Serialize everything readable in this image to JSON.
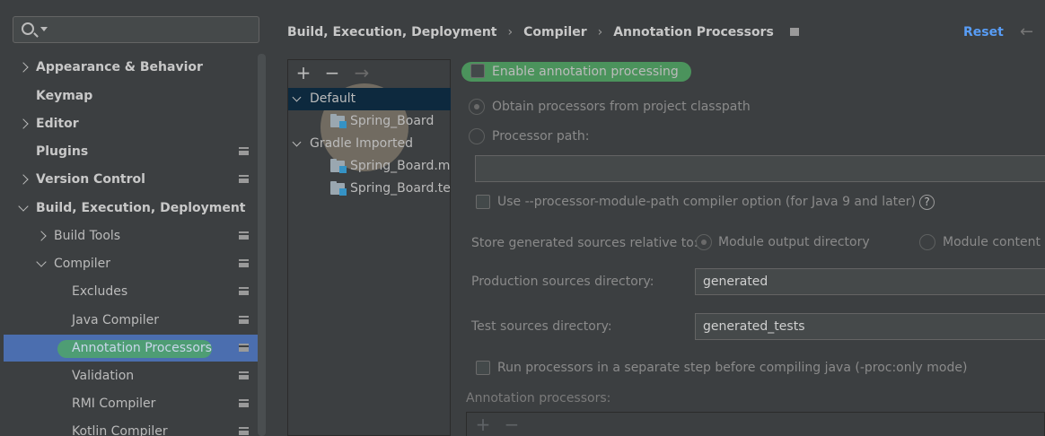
{
  "sidebar": {
    "search": {
      "value": "",
      "placeholder": ""
    },
    "items": [
      {
        "label": "Appearance & Behavior",
        "level": 0,
        "expanded": false,
        "bold": true
      },
      {
        "label": "Keymap",
        "level": 0,
        "bold": true
      },
      {
        "label": "Editor",
        "level": 0,
        "expanded": false,
        "bold": true
      },
      {
        "label": "Plugins",
        "level": 0,
        "bold": true
      },
      {
        "label": "Version Control",
        "level": 0,
        "expanded": false,
        "bold": true
      },
      {
        "label": "Build, Execution, Deployment",
        "level": 0,
        "expanded": true,
        "bold": true
      },
      {
        "label": "Build Tools",
        "level": 1,
        "expanded": false
      },
      {
        "label": "Compiler",
        "level": 1,
        "expanded": true
      },
      {
        "label": "Excludes",
        "level": 2
      },
      {
        "label": "Java Compiler",
        "level": 2
      },
      {
        "label": "Annotation Processors",
        "level": 2,
        "selected": true
      },
      {
        "label": "Validation",
        "level": 2
      },
      {
        "label": "RMI Compiler",
        "level": 2
      },
      {
        "label": "Kotlin Compiler",
        "level": 2
      }
    ]
  },
  "header": {
    "breadcrumb": [
      "Build, Execution, Deployment",
      "Compiler",
      "Annotation Processors"
    ],
    "separator": "›",
    "reset_label": "Reset",
    "back_icon": "←"
  },
  "profiles": {
    "toolbar": {
      "add": "+",
      "remove": "−",
      "move": "→"
    },
    "tree": [
      {
        "label": "Default",
        "level": 0,
        "expanded": true,
        "selected": true
      },
      {
        "label": "Spring_Board",
        "level": 1
      },
      {
        "label": "Gradle Imported",
        "level": 0,
        "expanded": true
      },
      {
        "label": "Spring_Board.main",
        "level": 1
      },
      {
        "label": "Spring_Board.test",
        "level": 1
      }
    ]
  },
  "settings": {
    "enable_label": "Enable annotation processing",
    "enable_checked": false,
    "obtain_label": "Obtain processors from project classpath",
    "processor_path_label": "Processor path:",
    "processor_path_value": "",
    "module_path_label": "Use --processor-module-path compiler option (for Java 9 and later)",
    "help_icon": "?",
    "store_label": "Store generated sources relative to:",
    "module_output_label": "Module output directory",
    "module_content_label": "Module content root",
    "production_label": "Production sources directory:",
    "production_value": "generated",
    "test_label": "Test sources directory:",
    "test_value": "generated_tests",
    "separate_step_label": "Run processors in a separate step before compiling java (-proc:only mode)",
    "annotation_processors_label": "Annotation processors:",
    "list_toolbar": {
      "add": "+",
      "remove": "−"
    }
  },
  "colors": {
    "background": "#3c3f41",
    "selection": "#4b6eaf",
    "tree_selection": "#0d293e",
    "link": "#589df6",
    "highlight": "#50aa64"
  }
}
